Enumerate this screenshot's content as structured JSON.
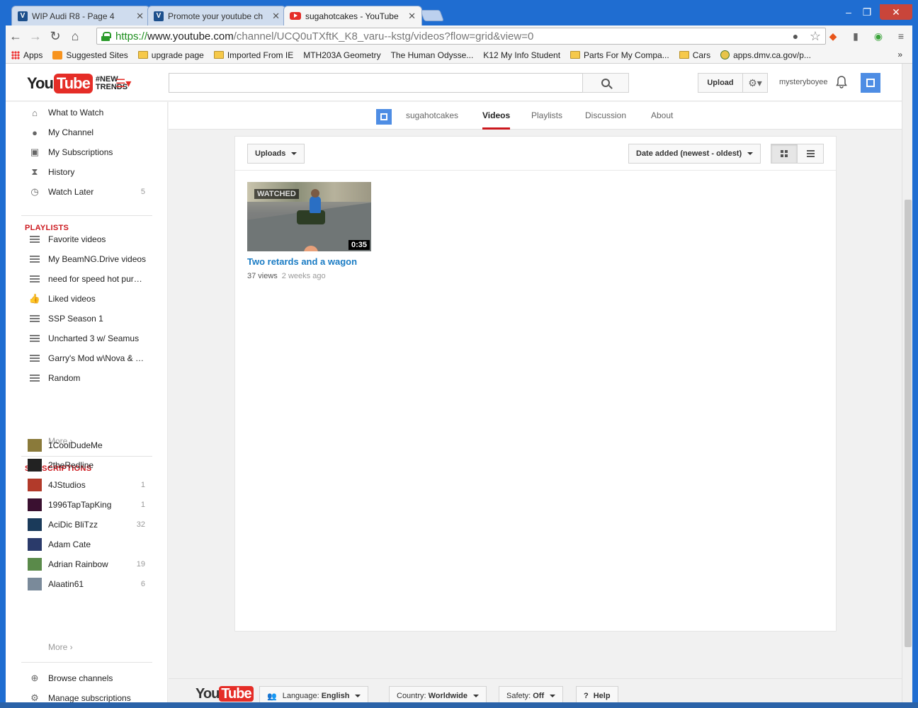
{
  "browser": {
    "tabs": [
      {
        "title": "WIP Audi R8 - Page 4",
        "favicon": "vbulletin-icon",
        "active": false
      },
      {
        "title": "Promote your youtube ch",
        "favicon": "vbulletin-icon",
        "active": false
      },
      {
        "title": "sugahotcakes - YouTube",
        "favicon": "youtube-icon",
        "active": true
      }
    ],
    "url": {
      "scheme": "https://",
      "host": "www.youtube.com",
      "path": "/channel/UCQ0uTXftK_K8_varu--kstg/videos?flow=grid&view=0"
    },
    "bookmarks": [
      {
        "label": "Apps",
        "icon": "apps"
      },
      {
        "label": "Suggested Sites",
        "icon": "sug"
      },
      {
        "label": "upgrade page",
        "icon": "folder"
      },
      {
        "label": "Imported From IE",
        "icon": "folder"
      },
      {
        "label": "MTH203A Geometry",
        "icon": "page"
      },
      {
        "label": "The Human Odysse...",
        "icon": "page"
      },
      {
        "label": "K12 My Info Student",
        "icon": "page"
      },
      {
        "label": "Parts For My Compa...",
        "icon": "folder"
      },
      {
        "label": "Cars",
        "icon": "folder"
      },
      {
        "label": "apps.dmv.ca.gov/p...",
        "icon": "globe"
      }
    ],
    "bookmarks_more": "»"
  },
  "masthead": {
    "logo_you": "You",
    "logo_tube": "Tube",
    "trend_line1": "#NEW",
    "trend_line2": "TRENDS",
    "upload_label": "Upload",
    "username": "mysteryboyee"
  },
  "sidebar": {
    "main": [
      {
        "label": "What to Watch",
        "icon": "home-icon",
        "count": ""
      },
      {
        "label": "My Channel",
        "icon": "user-icon",
        "count": ""
      },
      {
        "label": "My Subscriptions",
        "icon": "subscriptions-icon",
        "count": ""
      },
      {
        "label": "History",
        "icon": "hourglass-icon",
        "count": ""
      },
      {
        "label": "Watch Later",
        "icon": "clock-icon",
        "count": "5"
      }
    ],
    "playlists_heading": "PLAYLISTS",
    "playlists": [
      {
        "label": "Favorite videos",
        "icon": "playlist-icon"
      },
      {
        "label": "My BeamNG.Drive videos",
        "icon": "playlist-icon"
      },
      {
        "label": "need for speed hot pur…",
        "icon": "playlist-icon"
      },
      {
        "label": "Liked videos",
        "icon": "thumbs-up-icon"
      },
      {
        "label": "SSP Season 1",
        "icon": "playlist-icon"
      },
      {
        "label": "Uncharted 3 w/ Seamus",
        "icon": "playlist-icon"
      },
      {
        "label": "Garry's Mod w\\Nova & …",
        "icon": "playlist-icon"
      },
      {
        "label": "Random",
        "icon": "playlist-icon"
      }
    ],
    "more_label": "More ›",
    "subscriptions_heading": "SUBSCRIPTIONS",
    "subscriptions": [
      {
        "label": "1CoolDudeMe",
        "count": "",
        "color": "#8a7a3a"
      },
      {
        "label": "2theRedline",
        "count": "",
        "color": "#222222"
      },
      {
        "label": "4JStudios",
        "count": "1",
        "color": "#b23a2a"
      },
      {
        "label": "1996TapTapKing",
        "count": "1",
        "color": "#3a1030"
      },
      {
        "label": "AciDic BliTzz",
        "count": "32",
        "color": "#1a3a5a"
      },
      {
        "label": "Adam Cate",
        "count": "",
        "color": "#2a3a6a"
      },
      {
        "label": "Adrian Rainbow",
        "count": "19",
        "color": "#5a8a4a"
      },
      {
        "label": "Alaatin61",
        "count": "6",
        "color": "#7a8a9a"
      }
    ],
    "browse_label": "Browse channels",
    "manage_label": "Manage subscriptions"
  },
  "channel": {
    "name": "sugahotcakes",
    "tabs": [
      "Videos",
      "Playlists",
      "Discussion",
      "About"
    ],
    "active_tab": "Videos"
  },
  "videos_panel": {
    "filter_label": "Uploads",
    "sort_label": "Date added (newest - oldest)",
    "view_mode": "grid",
    "videos": [
      {
        "title": "Two retards and a wagon",
        "views": "37 views",
        "age": "2 weeks ago",
        "duration": "0:35",
        "badge": "WATCHED"
      }
    ]
  },
  "footer": {
    "logo_you": "You",
    "logo_tube": "Tube",
    "language_key": "Language:",
    "language_value": "English",
    "country_key": "Country:",
    "country_value": "Worldwide",
    "safety_key": "Safety:",
    "safety_value": "Off",
    "help_label": "Help"
  },
  "colors": {
    "accent_red": "#cc181e",
    "link_blue": "#1b7cc4",
    "window_blue": "#1f6dd1"
  }
}
